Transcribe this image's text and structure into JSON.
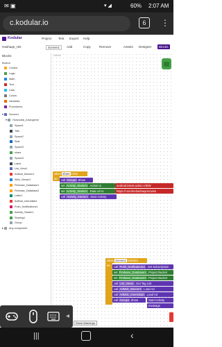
{
  "status": {
    "time": "2:07 AM",
    "battery": "60%"
  },
  "browser": {
    "url": "c.kodular.io",
    "tab_count": "6"
  },
  "app": {
    "brand": "Kodular",
    "menu": [
      "Project",
      "Test",
      "Export",
      "Help"
    ],
    "project_name": "Hashaqe_HD",
    "screen": "Screen1",
    "add_label": "Add",
    "copy_label": "Copy",
    "remove_label": "Remove",
    "designer_label": "Designer",
    "blocks_label": "Blocks",
    "assets_label": "Assets"
  },
  "panel": {
    "title": "Blocks",
    "builtin": "Built-in",
    "categories": [
      "Control",
      "Logic",
      "Math",
      "Text",
      "Lists",
      "Colors",
      "Variables",
      "Procedures"
    ],
    "screen": "Screen1",
    "arrangement": "Horizontal_Arrangeme",
    "components": [
      "Space1",
      "Title",
      "Space2",
      "Side",
      "Space3",
      "share",
      "Space4",
      "Label",
      "List_View1",
      "AdMob_Banner1",
      "Web_Viewer1",
      "Firebase_Database1",
      "Firebase_Database2",
      "Lottie1",
      "AdMob_Interstitial1",
      "Push_Notifications1",
      "Activity_Starter1",
      "Sharing1",
      "Group"
    ],
    "any_component": "Any component"
  },
  "blocks": {
    "event1": {
      "when": "when",
      "comp": "share",
      "evt": ".Click"
    },
    "do": "do",
    "call": "call",
    "set": "set",
    "group_show": {
      "comp": "Group1",
      "method": ".Show"
    },
    "set_action": {
      "comp": "Activity_Starter1",
      "prop": ".Action",
      "to": "to",
      "value": "android.intent.action.VIEW"
    },
    "set_data_uri": {
      "comp": "Activity_Starter1",
      "prop": ".Data Uri",
      "to": "to",
      "value": "https://t.me/mehashaqemovies"
    },
    "start": {
      "comp": "Activity_Starter1",
      "method": ".Start Activity"
    },
    "event2": {
      "when": "when",
      "comp": "Screen1",
      "evt": ".Initialize"
    },
    "push": {
      "comp": "Push_Notifications1",
      "method": ".Set Subscription"
    },
    "fb1": {
      "comp": "Firebase_Database1",
      "prop": ".Project Bucket"
    },
    "fb2": {
      "comp": "Firebase_Database2",
      "prop": ".Project Bucket"
    },
    "list_view": {
      "comp": "List_View1",
      "method": ".Get Tag List"
    },
    "admob_banner": {
      "comp": "AdMob_Banner1",
      "method": ".Load Ad"
    },
    "admob_inter": {
      "comp": "AdMob_Interstitial1",
      "method": ".Load Ad"
    },
    "group_show2": {
      "comp": "Group1",
      "method": ".Show"
    },
    "start2": {
      "method": "Start Activity"
    },
    "message": "message",
    "show_warnings": "Show Warnings",
    "warning_count": "0",
    "error_count": "0"
  },
  "colors": {
    "accent": "#5c6bc0",
    "kodular_purple": "#4a148c"
  }
}
